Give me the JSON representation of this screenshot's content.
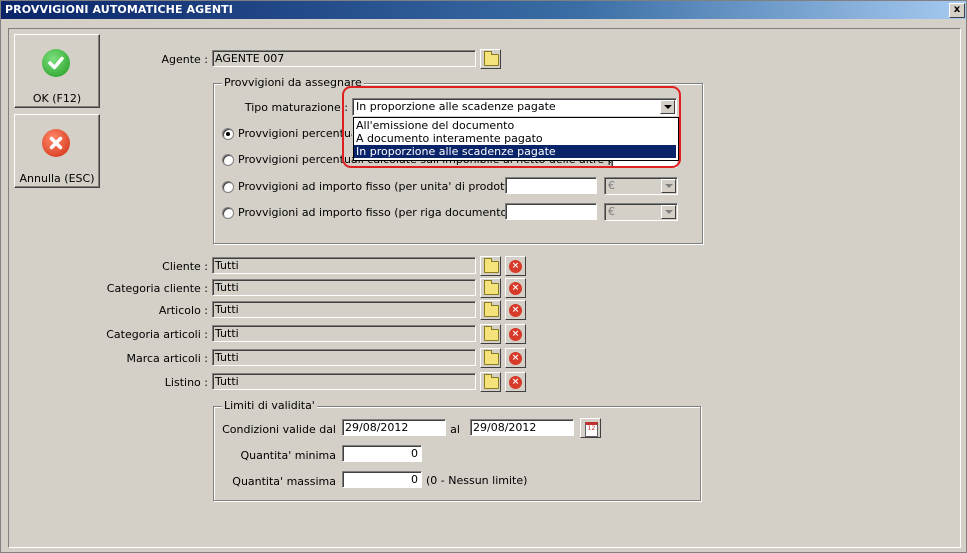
{
  "window": {
    "title": "PROVVIGIONI AUTOMATICHE AGENTI",
    "close_label": "x"
  },
  "buttons": {
    "ok_label": "OK (F12)",
    "cancel_label": "Annulla (ESC)"
  },
  "agent": {
    "label": "Agente :",
    "value": "AGENTE 007"
  },
  "provvigioni": {
    "group_title": "Provvigioni da assegnare",
    "tipo_label": "Tipo maturazione :",
    "tipo_value": "In proporzione alle scadenze pagate",
    "dropdown_options": [
      "All'emissione del documento",
      "A documento interamente pagato",
      "In proporzione alle scadenze pagate"
    ],
    "radio1_label": "Provvigioni percentuali c",
    "radio2_label": "Provvigioni percentuali calcolate sull'imponibile al netto delle altre provvigioni",
    "radio3_label": "Provvigioni ad importo fisso (per unita' di prodotto)",
    "radio4_label": "Provvigioni ad importo fisso (per riga documento)",
    "currency": "€"
  },
  "filters": [
    {
      "label": "Cliente :",
      "value": "Tutti"
    },
    {
      "label": "Categoria cliente :",
      "value": "Tutti"
    },
    {
      "label": "Articolo :",
      "value": "Tutti"
    },
    {
      "label": "Categoria articoli :",
      "value": "Tutti"
    },
    {
      "label": "Marca articoli :",
      "value": "Tutti"
    },
    {
      "label": "Listino :",
      "value": "Tutti"
    }
  ],
  "limiti": {
    "group_title": "Limiti di validita'",
    "dal_label": "Condizioni valide dal",
    "dal_value": "29/08/2012",
    "al_label": "al",
    "al_value": "29/08/2012",
    "qmin_label": "Quantita' minima",
    "qmin_value": "0",
    "qmax_label": "Quantita' massima",
    "qmax_value": "0",
    "qmax_hint": "(0 - Nessun limite)",
    "cal_text": "12"
  }
}
